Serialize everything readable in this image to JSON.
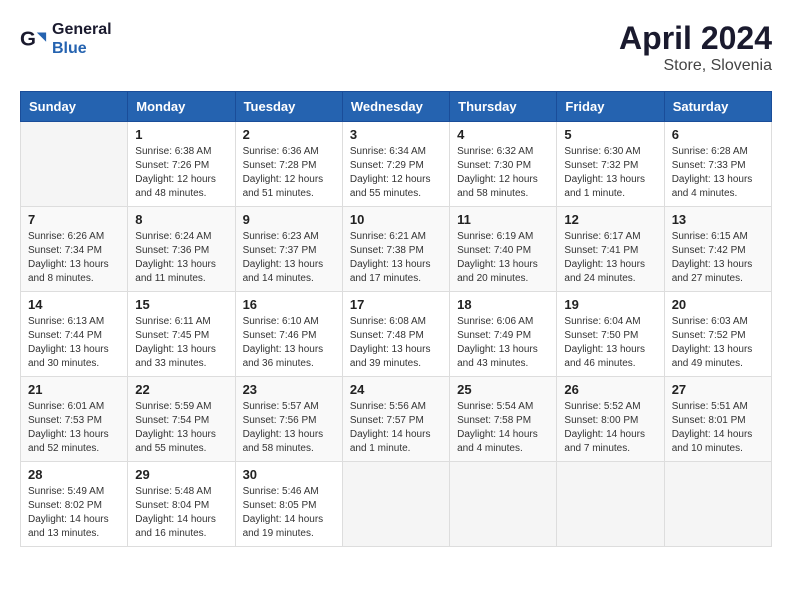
{
  "header": {
    "logo_line1": "General",
    "logo_line2": "Blue",
    "month_year": "April 2024",
    "location": "Store, Slovenia"
  },
  "days_of_week": [
    "Sunday",
    "Monday",
    "Tuesday",
    "Wednesday",
    "Thursday",
    "Friday",
    "Saturday"
  ],
  "weeks": [
    [
      {
        "day": "",
        "info": ""
      },
      {
        "day": "1",
        "info": "Sunrise: 6:38 AM\nSunset: 7:26 PM\nDaylight: 12 hours\nand 48 minutes."
      },
      {
        "day": "2",
        "info": "Sunrise: 6:36 AM\nSunset: 7:28 PM\nDaylight: 12 hours\nand 51 minutes."
      },
      {
        "day": "3",
        "info": "Sunrise: 6:34 AM\nSunset: 7:29 PM\nDaylight: 12 hours\nand 55 minutes."
      },
      {
        "day": "4",
        "info": "Sunrise: 6:32 AM\nSunset: 7:30 PM\nDaylight: 12 hours\nand 58 minutes."
      },
      {
        "day": "5",
        "info": "Sunrise: 6:30 AM\nSunset: 7:32 PM\nDaylight: 13 hours\nand 1 minute."
      },
      {
        "day": "6",
        "info": "Sunrise: 6:28 AM\nSunset: 7:33 PM\nDaylight: 13 hours\nand 4 minutes."
      }
    ],
    [
      {
        "day": "7",
        "info": "Sunrise: 6:26 AM\nSunset: 7:34 PM\nDaylight: 13 hours\nand 8 minutes."
      },
      {
        "day": "8",
        "info": "Sunrise: 6:24 AM\nSunset: 7:36 PM\nDaylight: 13 hours\nand 11 minutes."
      },
      {
        "day": "9",
        "info": "Sunrise: 6:23 AM\nSunset: 7:37 PM\nDaylight: 13 hours\nand 14 minutes."
      },
      {
        "day": "10",
        "info": "Sunrise: 6:21 AM\nSunset: 7:38 PM\nDaylight: 13 hours\nand 17 minutes."
      },
      {
        "day": "11",
        "info": "Sunrise: 6:19 AM\nSunset: 7:40 PM\nDaylight: 13 hours\nand 20 minutes."
      },
      {
        "day": "12",
        "info": "Sunrise: 6:17 AM\nSunset: 7:41 PM\nDaylight: 13 hours\nand 24 minutes."
      },
      {
        "day": "13",
        "info": "Sunrise: 6:15 AM\nSunset: 7:42 PM\nDaylight: 13 hours\nand 27 minutes."
      }
    ],
    [
      {
        "day": "14",
        "info": "Sunrise: 6:13 AM\nSunset: 7:44 PM\nDaylight: 13 hours\nand 30 minutes."
      },
      {
        "day": "15",
        "info": "Sunrise: 6:11 AM\nSunset: 7:45 PM\nDaylight: 13 hours\nand 33 minutes."
      },
      {
        "day": "16",
        "info": "Sunrise: 6:10 AM\nSunset: 7:46 PM\nDaylight: 13 hours\nand 36 minutes."
      },
      {
        "day": "17",
        "info": "Sunrise: 6:08 AM\nSunset: 7:48 PM\nDaylight: 13 hours\nand 39 minutes."
      },
      {
        "day": "18",
        "info": "Sunrise: 6:06 AM\nSunset: 7:49 PM\nDaylight: 13 hours\nand 43 minutes."
      },
      {
        "day": "19",
        "info": "Sunrise: 6:04 AM\nSunset: 7:50 PM\nDaylight: 13 hours\nand 46 minutes."
      },
      {
        "day": "20",
        "info": "Sunrise: 6:03 AM\nSunset: 7:52 PM\nDaylight: 13 hours\nand 49 minutes."
      }
    ],
    [
      {
        "day": "21",
        "info": "Sunrise: 6:01 AM\nSunset: 7:53 PM\nDaylight: 13 hours\nand 52 minutes."
      },
      {
        "day": "22",
        "info": "Sunrise: 5:59 AM\nSunset: 7:54 PM\nDaylight: 13 hours\nand 55 minutes."
      },
      {
        "day": "23",
        "info": "Sunrise: 5:57 AM\nSunset: 7:56 PM\nDaylight: 13 hours\nand 58 minutes."
      },
      {
        "day": "24",
        "info": "Sunrise: 5:56 AM\nSunset: 7:57 PM\nDaylight: 14 hours\nand 1 minute."
      },
      {
        "day": "25",
        "info": "Sunrise: 5:54 AM\nSunset: 7:58 PM\nDaylight: 14 hours\nand 4 minutes."
      },
      {
        "day": "26",
        "info": "Sunrise: 5:52 AM\nSunset: 8:00 PM\nDaylight: 14 hours\nand 7 minutes."
      },
      {
        "day": "27",
        "info": "Sunrise: 5:51 AM\nSunset: 8:01 PM\nDaylight: 14 hours\nand 10 minutes."
      }
    ],
    [
      {
        "day": "28",
        "info": "Sunrise: 5:49 AM\nSunset: 8:02 PM\nDaylight: 14 hours\nand 13 minutes."
      },
      {
        "day": "29",
        "info": "Sunrise: 5:48 AM\nSunset: 8:04 PM\nDaylight: 14 hours\nand 16 minutes."
      },
      {
        "day": "30",
        "info": "Sunrise: 5:46 AM\nSunset: 8:05 PM\nDaylight: 14 hours\nand 19 minutes."
      },
      {
        "day": "",
        "info": ""
      },
      {
        "day": "",
        "info": ""
      },
      {
        "day": "",
        "info": ""
      },
      {
        "day": "",
        "info": ""
      }
    ]
  ]
}
